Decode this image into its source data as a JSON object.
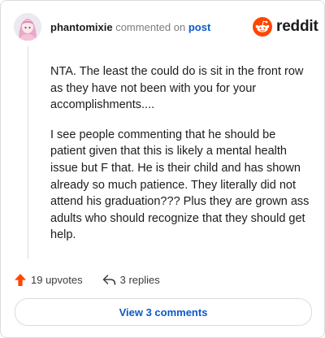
{
  "comment": {
    "username": "phantomixie",
    "commented_on_text": "commented on",
    "post_link": "post",
    "paragraphs": [
      "NTA. The least the could do is sit in the front row as they have not been with you for your accomplishments....",
      "I see people commenting that he should be patient given that this is likely a mental health issue but F that. He is their child and has shown already so much patience. They literally did not attend his graduation??? Plus they are grown ass adults who should recognize that they should get help."
    ]
  },
  "brand": {
    "wordmark": "reddit",
    "color": "#ff4500"
  },
  "actions": {
    "upvotes": "19 upvotes",
    "upvote_icon": "upvote-arrow-icon",
    "replies": "3 replies",
    "reply_icon": "reply-arrow-icon"
  },
  "view_button": {
    "label": "View 3 comments"
  },
  "colors": {
    "link": "#0b59c9",
    "upvote": "#ff4500",
    "border": "#dcdcdc"
  }
}
